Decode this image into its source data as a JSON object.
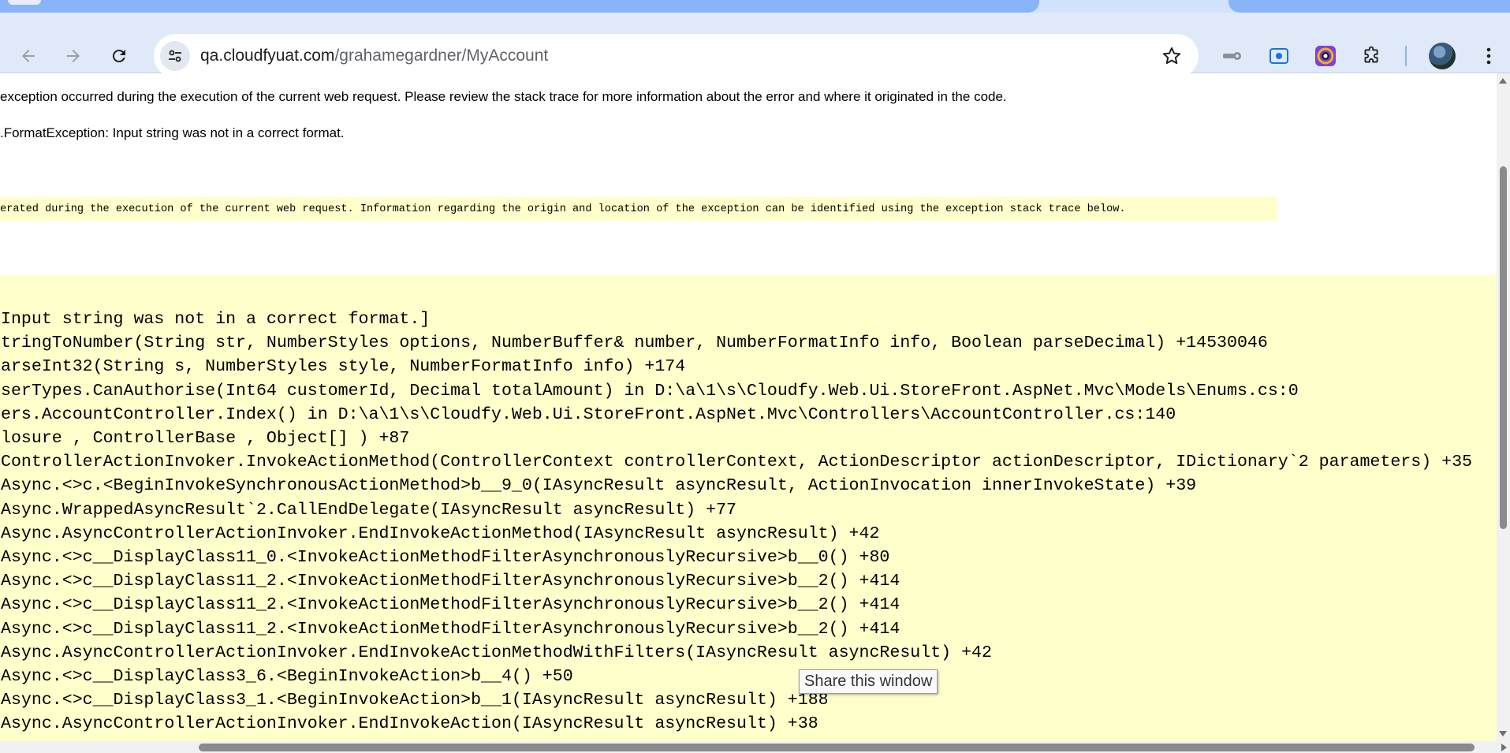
{
  "browser": {
    "url_host": "qa.cloudfyuat.com",
    "url_path": "/grahamegardner/MyAccount",
    "tooltip": "Share this window"
  },
  "error_page": {
    "description": "exception occurred during the execution of the current web request. Please review the stack trace for more information about the error and where it originated in the code.",
    "exception_details": ".FormatException: Input string was not in a correct format.",
    "source_error": "erated during the execution of the current web request. Information regarding the origin and location of the exception can be identified using the exception stack trace below.",
    "stack_trace": [
      "Input string was not in a correct format.]",
      "tringToNumber(String str, NumberStyles options, NumberBuffer& number, NumberFormatInfo info, Boolean parseDecimal) +14530046",
      "arseInt32(String s, NumberStyles style, NumberFormatInfo info) +174",
      "serTypes.CanAuthorise(Int64 customerId, Decimal totalAmount) in D:\\a\\1\\s\\Cloudfy.Web.Ui.StoreFront.AspNet.Mvc\\Models\\Enums.cs:0",
      "ers.AccountController.Index() in D:\\a\\1\\s\\Cloudfy.Web.Ui.StoreFront.AspNet.Mvc\\Controllers\\AccountController.cs:140",
      "losure , ControllerBase , Object[] ) +87",
      "ControllerActionInvoker.InvokeActionMethod(ControllerContext controllerContext, ActionDescriptor actionDescriptor, IDictionary`2 parameters) +35",
      "Async.<>c.<BeginInvokeSynchronousActionMethod>b__9_0(IAsyncResult asyncResult, ActionInvocation innerInvokeState) +39",
      "Async.WrappedAsyncResult`2.CallEndDelegate(IAsyncResult asyncResult) +77",
      "Async.AsyncControllerActionInvoker.EndInvokeActionMethod(IAsyncResult asyncResult) +42",
      "Async.<>c__DisplayClass11_0.<InvokeActionMethodFilterAsynchronouslyRecursive>b__0() +80",
      "Async.<>c__DisplayClass11_2.<InvokeActionMethodFilterAsynchronouslyRecursive>b__2() +414",
      "Async.<>c__DisplayClass11_2.<InvokeActionMethodFilterAsynchronouslyRecursive>b__2() +414",
      "Async.<>c__DisplayClass11_2.<InvokeActionMethodFilterAsynchronouslyRecursive>b__2() +414",
      "Async.AsyncControllerActionInvoker.EndInvokeActionMethodWithFilters(IAsyncResult asyncResult) +42",
      "Async.<>c__DisplayClass3_6.<BeginInvokeAction>b__4() +50",
      "Async.<>c__DisplayClass3_1.<BeginInvokeAction>b__1(IAsyncResult asyncResult) +188",
      "Async.AsyncControllerActionInvoker.EndInvokeAction(IAsyncResult asyncResult) +38"
    ]
  }
}
